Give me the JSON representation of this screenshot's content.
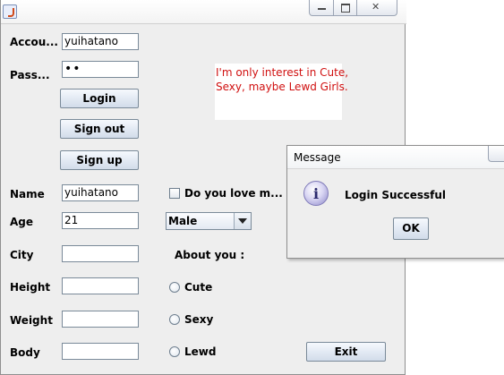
{
  "main_window": {
    "title": "",
    "controls": {
      "minimize": "minimize",
      "maximize": "maximize",
      "close": "close"
    }
  },
  "form": {
    "account_label": "Accou...",
    "account_value": "yuihatano",
    "password_label": "Pass...",
    "password_value": "••",
    "login_button": "Login",
    "signout_button": "Sign out",
    "signup_button": "Sign up",
    "note_text_line1": "I'm only interest in Cute,",
    "note_text_line2": "Sexy, maybe Lewd Girls.",
    "name_label": "Name",
    "name_value": "yuihatano",
    "love_checkbox_label": "Do you love m...",
    "love_checked": false,
    "age_label": "Age",
    "age_value": "21",
    "gender_selected": "Male",
    "city_label": "City",
    "city_value": "",
    "about_label": "About you :",
    "height_label": "Height",
    "height_value": "",
    "weight_label": "Weight",
    "weight_value": "",
    "body_label": "Body",
    "body_value": "",
    "radio_cute": "Cute",
    "radio_sexy": "Sexy",
    "radio_lewd": "Lewd",
    "exit_button": "Exit"
  },
  "dialog": {
    "title": "Message",
    "icon": "info-icon",
    "message": "Login Successful",
    "ok_button": "OK"
  },
  "colors": {
    "window_bg": "#eeeeee",
    "note_text": "#d01010"
  }
}
